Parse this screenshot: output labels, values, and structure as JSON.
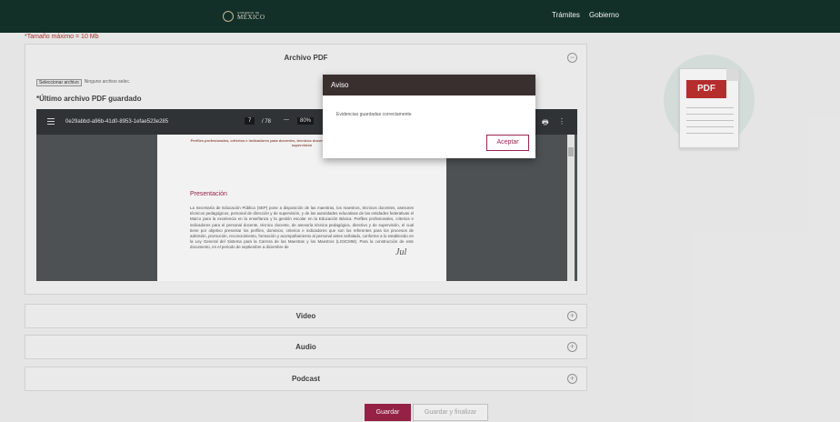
{
  "header": {
    "logo_small": "GOBIERNO DE",
    "logo_big": "MÉXICO",
    "nav": [
      "Trámites",
      "Gobierno"
    ]
  },
  "notice": "*Tamaño máximo = 10 Mb",
  "sections": {
    "pdf": "Archivo PDF",
    "video": "Video",
    "audio": "Audio",
    "podcast": "Podcast"
  },
  "file_input": {
    "button_label": "Seleccionar archivo",
    "status": "Ninguno archivo selec."
  },
  "last_saved_label": "*Último archivo PDF guardado",
  "viewer": {
    "filename": "0e29abbd-a96b-41d0-8953-1efae523e285",
    "current_page": "7",
    "total_pages": "/ 78",
    "zoom": "80%",
    "zoom_out": "—"
  },
  "pdf_page": {
    "subtitle": "Perfiles profesionales, criterios e indicadores para docentes, técnicos docentes, de asesoría técnico pedagógica, directivos y de supervisión",
    "heading": "Presentación",
    "body": "La Secretaría de Educación Pública (SEP) pone a disposición de las maestras, los maestros, técnicos docentes, asesores técnicos pedagógicos, personal de dirección y de supervisión, y de las autoridades educativas de las entidades federativas el Marco para la excelencia en la enseñanza y la gestión escolar en la Educación Básica. Perfiles profesionales, criterios e indicadores para el personal docente, técnico docente, de asesoría técnica pedagógica, directivo y de supervisión, el cual tiene por objetivo presentar los perfiles, dominios, criterios e indicadores que son los referentes para los procesos de admisión, promoción, reconocimiento, formación y acompañamiento al personal antes señalado, conforme a lo establecido en la Ley General del Sistema para la Carrera de las Maestras y los Maestros (LGSCMM). Para la construcción de este documento, en el periodo de septiembre a diciembre de",
    "signature": "Jul"
  },
  "pdf_icon_label": "PDF",
  "buttons": {
    "save": "Guardar",
    "save_finish": "Guardar y finalizar"
  },
  "modal": {
    "title": "Aviso",
    "message": "Evidencias guardadas correctamente",
    "accept": "Aceptar"
  },
  "colors": {
    "header_bg": "#13322b",
    "accent": "#9d2449",
    "modal_header": "#3a2f2f",
    "notice": "#b3372f"
  }
}
